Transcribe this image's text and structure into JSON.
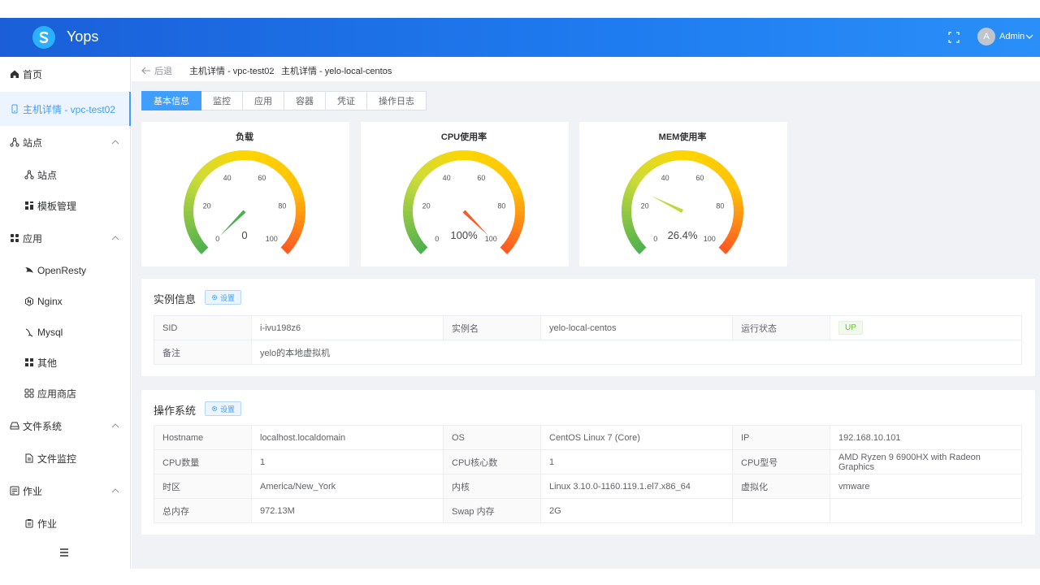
{
  "app": {
    "brand": "Yops"
  },
  "header": {
    "user": "Admin",
    "avatar_letter": "A"
  },
  "sidebar": {
    "items": [
      {
        "label": "首页",
        "icon": "home-icon",
        "level": 0
      },
      {
        "label": "主机详情 - vpc-test02",
        "icon": "server-icon",
        "level": 0,
        "active": true
      },
      {
        "label": "站点",
        "icon": "sitemap-icon",
        "level": 0,
        "expandable": true
      },
      {
        "label": "站点",
        "icon": "sitemap-icon",
        "level": 1
      },
      {
        "label": "模板管理",
        "icon": "template-icon",
        "level": 1
      },
      {
        "label": "应用",
        "icon": "apps-icon",
        "level": 0,
        "expandable": true
      },
      {
        "label": "OpenResty",
        "icon": "openresty-icon",
        "level": 1
      },
      {
        "label": "Nginx",
        "icon": "nginx-icon",
        "level": 1
      },
      {
        "label": "Mysql",
        "icon": "mysql-icon",
        "level": 1
      },
      {
        "label": "其他",
        "icon": "grid-icon",
        "level": 1
      },
      {
        "label": "应用商店",
        "icon": "store-icon",
        "level": 1
      },
      {
        "label": "文件系统",
        "icon": "drive-icon",
        "level": 0,
        "expandable": true
      },
      {
        "label": "文件监控",
        "icon": "file-icon",
        "level": 1
      },
      {
        "label": "作业",
        "icon": "job-icon",
        "level": 0,
        "expandable": true
      },
      {
        "label": "作业",
        "icon": "clipboard-icon",
        "level": 1
      }
    ]
  },
  "breadcrumb": {
    "back": "后退",
    "crumbs": [
      "主机详情 - vpc-test02",
      "主机详情 - yelo-local-centos"
    ]
  },
  "tabs": [
    "基本信息",
    "监控",
    "应用",
    "容器",
    "凭证",
    "操作日志"
  ],
  "gauges": [
    {
      "title": "负载",
      "value": 0,
      "display": "0",
      "min": 0,
      "max": 100,
      "ticks": [
        "0",
        "20",
        "40",
        "60",
        "80",
        "100"
      ]
    },
    {
      "title": "CPU使用率",
      "value": 100,
      "display": "100%",
      "min": 0,
      "max": 100,
      "ticks": [
        "0",
        "20",
        "40",
        "60",
        "80",
        "100"
      ]
    },
    {
      "title": "MEM使用率",
      "value": 26.4,
      "display": "26.4%",
      "min": 0,
      "max": 100,
      "ticks": [
        "0",
        "20",
        "40",
        "60",
        "80",
        "100"
      ]
    }
  ],
  "instance": {
    "title": "实例信息",
    "settings": "设置",
    "rows": [
      [
        [
          "SID",
          "i-ivu198z6"
        ],
        [
          "实例名",
          "yelo-local-centos"
        ],
        [
          "运行状态",
          "UP"
        ]
      ],
      [
        [
          "备注",
          "yelo的本地虚拟机"
        ]
      ]
    ]
  },
  "os": {
    "title": "操作系统",
    "settings": "设置",
    "rows": [
      [
        [
          "Hostname",
          "localhost.localdomain"
        ],
        [
          "OS",
          "CentOS Linux 7 (Core)"
        ],
        [
          "IP",
          "192.168.10.101"
        ]
      ],
      [
        [
          "CPU数量",
          "1"
        ],
        [
          "CPU核心数",
          "1"
        ],
        [
          "CPU型号",
          "AMD Ryzen 9 6900HX with Radeon Graphics"
        ]
      ],
      [
        [
          "时区",
          "America/New_York"
        ],
        [
          "内核",
          "Linux 3.10.0-1160.119.1.el7.x86_64"
        ],
        [
          "虚拟化",
          "vmware"
        ]
      ],
      [
        [
          "总内存",
          "972.13M"
        ],
        [
          "Swap 内存",
          "2G"
        ]
      ]
    ]
  },
  "colors": {
    "accent": "#409eff",
    "header": "#1f7cf0",
    "up": "#67c23a"
  }
}
